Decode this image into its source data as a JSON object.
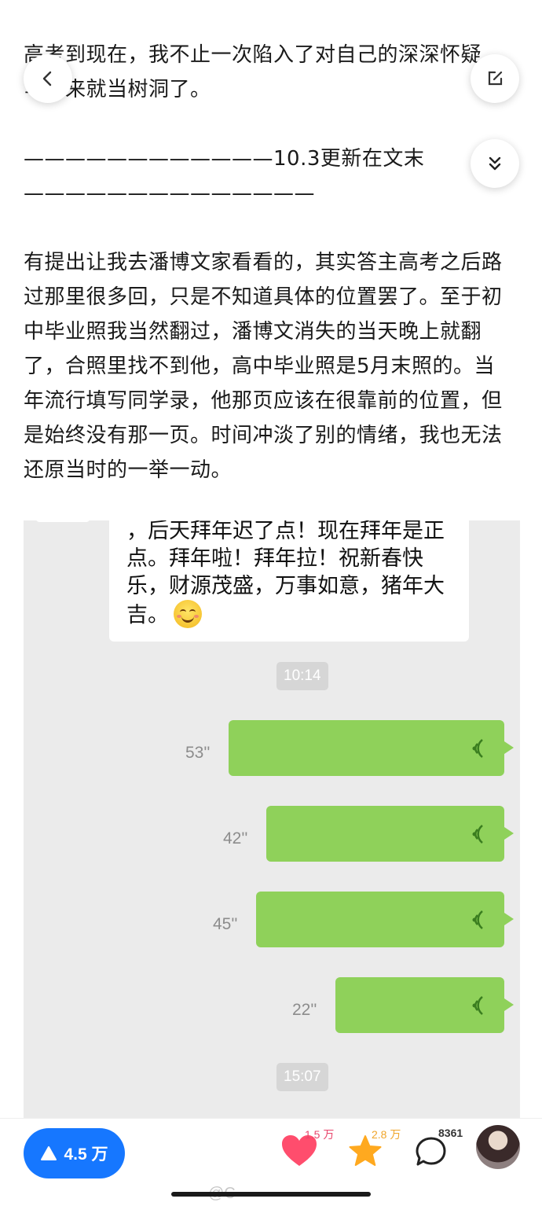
{
  "article": {
    "para_top": "高考到现在，我不止一次陷入了对自己的深深怀疑，写出来就当树洞了。",
    "divider": "————————————10.3更新在文末\n——————————————",
    "para_body": "有提出让我去潘博文家看看的，其实答主高考之后路过那里很多回，只是不知道具体的位置罢了。至于初中毕业照我当然翻过，潘博文消失的当天晚上就翻了，合照里找不到他，高中毕业照是5月末照的。当年流行填写同学录，他那页应该在很靠前的位置，但是始终没有那一页。时间冲淡了别的情绪，我也无法还原当时的一举一动。"
  },
  "chat": {
    "incoming_text": "，后天拜年迟了点！现在拜年是正点。拜年啦！拜年拉！祝新春快乐，财源茂盛，万事如意，猪年大吉。",
    "timestamps": [
      "10:14",
      "15:07"
    ],
    "voice_messages": [
      {
        "duration": "53''"
      },
      {
        "duration": "42''"
      },
      {
        "duration": "45''"
      },
      {
        "duration": "22''"
      }
    ]
  },
  "bottom_bar": {
    "vote_count": "4.5 万",
    "like_count": "1.5 万",
    "favorite_count": "2.8 万",
    "comment_count": "8361",
    "watermark": "@C"
  },
  "colors": {
    "accent": "#1677ff",
    "voice_bubble": "#8fd15a",
    "like": "#ff4d6d",
    "favorite": "#ffa91f"
  }
}
